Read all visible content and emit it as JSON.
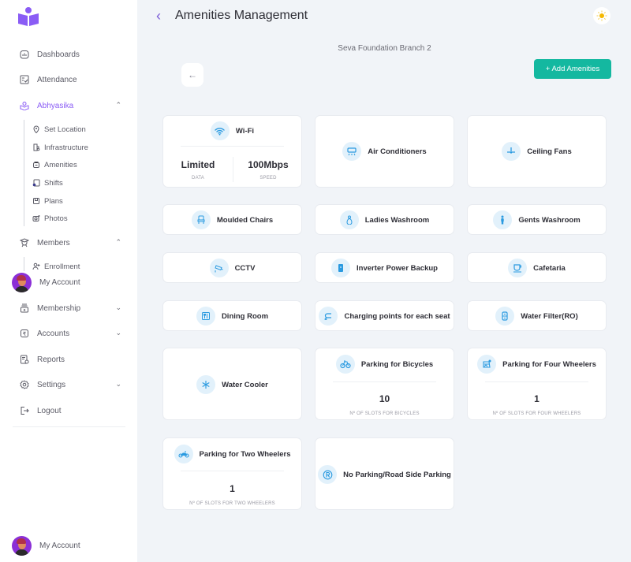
{
  "app": {
    "brand_color": "#8a5cf5",
    "accent_color": "#14b8a0",
    "icon_color": "#2a9ae0"
  },
  "sidebar": {
    "items": [
      {
        "label": "Dashboards",
        "icon": "dashboard-icon"
      },
      {
        "label": "Attendance",
        "icon": "attendance-icon"
      },
      {
        "label": "Abhyasika",
        "icon": "abhyasika-icon",
        "active": true,
        "expanded": true,
        "children": [
          {
            "label": "Set Location",
            "icon": "location-pin-icon"
          },
          {
            "label": "Infrastructure",
            "icon": "infrastructure-icon"
          },
          {
            "label": "Amenities",
            "icon": "amenities-icon"
          },
          {
            "label": "Shifts",
            "icon": "shifts-icon"
          },
          {
            "label": "Plans",
            "icon": "plans-icon"
          },
          {
            "label": "Photos",
            "icon": "photos-icon"
          }
        ]
      },
      {
        "label": "Members",
        "icon": "members-icon",
        "expanded": true,
        "children": [
          {
            "label": "Enrollment",
            "icon": "enrollment-icon"
          }
        ]
      },
      {
        "label": "Membership",
        "icon": "membership-icon"
      },
      {
        "label": "Accounts",
        "icon": "rupee-icon"
      },
      {
        "label": "Reports",
        "icon": "reports-icon"
      },
      {
        "label": "Settings",
        "icon": "gear-icon"
      },
      {
        "label": "Logout",
        "icon": "logout-icon"
      }
    ],
    "account_overlay_label": "My Account",
    "account_label": "My Account"
  },
  "header": {
    "title": "Amenities Management",
    "branch": "Seva Foundation Branch 2",
    "add_button": "+ Add Amenities",
    "back_icon": "←"
  },
  "amenities": [
    {
      "name": "Wi-Fi",
      "icon": "wifi-icon",
      "stats": [
        {
          "value": "Limited",
          "caption": "DATA"
        },
        {
          "value": "100Mbps",
          "caption": "SPEED"
        }
      ]
    },
    {
      "name": "Air Conditioners",
      "icon": "air-conditioner-icon"
    },
    {
      "name": "Ceiling Fans",
      "icon": "ceiling-fan-icon"
    },
    {
      "name": "Moulded Chairs",
      "icon": "chair-icon"
    },
    {
      "name": "Ladies Washroom",
      "icon": "ladies-washroom-icon"
    },
    {
      "name": "Gents Washroom",
      "icon": "gents-washroom-icon"
    },
    {
      "name": "CCTV",
      "icon": "cctv-icon"
    },
    {
      "name": "Inverter Power Backup",
      "icon": "inverter-icon"
    },
    {
      "name": "Cafetaria",
      "icon": "coffee-cup-icon"
    },
    {
      "name": "Dining Room",
      "icon": "dining-icon"
    },
    {
      "name": "Charging points for each seat",
      "icon": "charging-plug-icon"
    },
    {
      "name": "Water Filter(RO)",
      "icon": "water-filter-icon"
    },
    {
      "name": "Water Cooler",
      "icon": "snowflake-icon"
    },
    {
      "name": "Parking for Bicycles",
      "icon": "bicycle-icon",
      "count": "10",
      "caption": "Nº OF SLOTS FOR BICYCLES"
    },
    {
      "name": "Parking for Four Wheelers",
      "icon": "car-icon",
      "count": "1",
      "caption": "Nº OF SLOTS FOR FOUR WHEELERS"
    },
    {
      "name": "Parking for Two Wheelers",
      "icon": "motorbike-icon",
      "count": "1",
      "caption": "Nº OF SLOTS FOR TWO WHEELERS"
    },
    {
      "name": "No Parking/Road Side Parking",
      "icon": "parking-icon"
    }
  ]
}
